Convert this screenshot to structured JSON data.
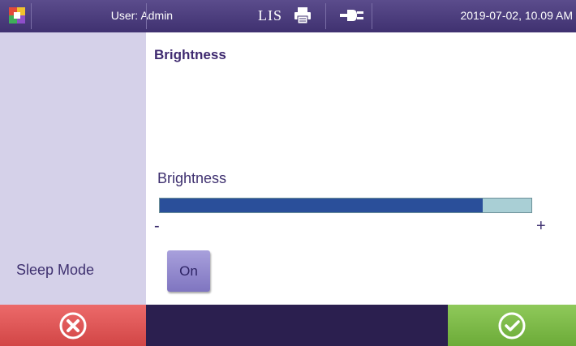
{
  "header": {
    "user_label": "User: Admin",
    "lis_label": "LIS",
    "datetime": "2019-07-02, 10.09 AM",
    "icons": [
      "app-logo-icon",
      "printer-icon",
      "power-plug-icon"
    ]
  },
  "main": {
    "section_title": "Brightness",
    "brightness_label": "Brightness",
    "brightness_level": 0.87,
    "minus_label": "-",
    "plus_label": "+",
    "sleep_mode_label": "Sleep Mode",
    "sleep_mode_value": "On"
  },
  "footer": {
    "cancel_icon": "cancel-x-icon",
    "confirm_icon": "confirm-check-icon"
  },
  "colors": {
    "header_bg": "#4b3d7e",
    "side_panel_bg": "#d5d1e9",
    "slider_fill": "#2a4f9a",
    "slider_track": "#a9cfd5",
    "cancel_red": "#e05858",
    "confirm_green": "#7dbb48",
    "footer_bg": "#2b1f4f"
  }
}
